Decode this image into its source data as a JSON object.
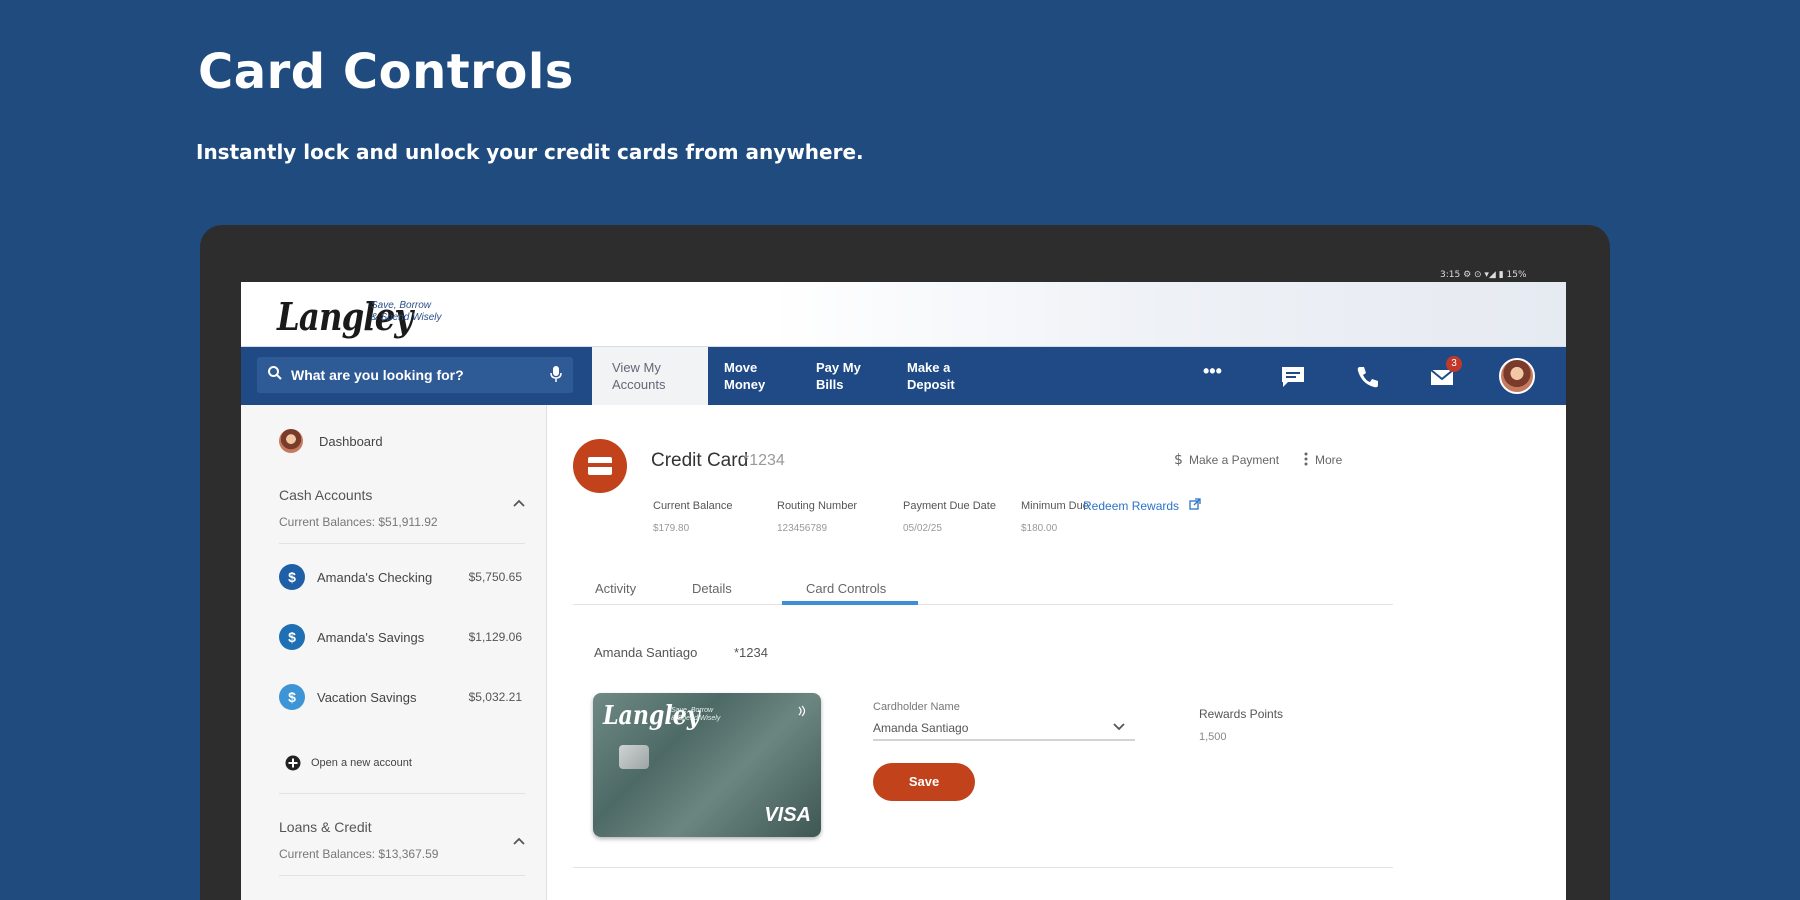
{
  "promo": {
    "title": "Card Controls",
    "subtitle": "Instantly lock and unlock your credit cards from anywhere."
  },
  "statusbar": {
    "text": "3:15 ⚙ ⊙ ▾◢ ▮ 15%"
  },
  "brand": {
    "logo": "Langley",
    "tagline_1": "Save, Borrow",
    "tagline_2": "& Spend Wisely"
  },
  "search": {
    "placeholder": "What are you looking for?"
  },
  "nav": {
    "tabs": [
      {
        "line1": "View My",
        "line2": "Accounts"
      },
      {
        "line1": "Move",
        "line2": "Money"
      },
      {
        "line1": "Pay My",
        "line2": "Bills"
      },
      {
        "line1": "Make a",
        "line2": "Deposit"
      }
    ],
    "more": "•••",
    "mail_badge": "3"
  },
  "sidebar": {
    "dashboard": "Dashboard",
    "cash": {
      "title": "Cash Accounts",
      "balance": "Current Balances: $51,911.92"
    },
    "accounts": [
      {
        "name": "Amanda's Checking",
        "balance": "$5,750.65"
      },
      {
        "name": "Amanda's Savings",
        "balance": "$1,129.06"
      },
      {
        "name": "Vacation Savings",
        "balance": "$5,032.21"
      }
    ],
    "open_account": "Open a new account",
    "loans": {
      "title": "Loans & Credit",
      "balance": "Current Balances: $13,367.59"
    }
  },
  "main": {
    "title": "Credit Card",
    "mask": "*1234",
    "make_payment": "Make a Payment",
    "more": "More",
    "meta": [
      {
        "label": "Current Balance",
        "value": "$179.80"
      },
      {
        "label": "Routing Number",
        "value": "123456789"
      },
      {
        "label": "Payment Due Date",
        "value": "05/02/25"
      },
      {
        "label": "Minimum Due",
        "value": "$180.00"
      }
    ],
    "redeem": "Redeem Rewards",
    "tabs": [
      "Activity",
      "Details",
      "Card Controls"
    ],
    "holder_name": "Amanda Santiago",
    "holder_mask": "*1234",
    "card": {
      "logo": "Langley",
      "tagline_1": "Save, Borrow",
      "tagline_2": "& Spend Wisely",
      "network": "VISA"
    },
    "cardholder_label": "Cardholder Name",
    "cardholder_value": "Amanda Santiago",
    "save": "Save",
    "rewards_label": "Rewards Points",
    "rewards_value": "1,500"
  }
}
